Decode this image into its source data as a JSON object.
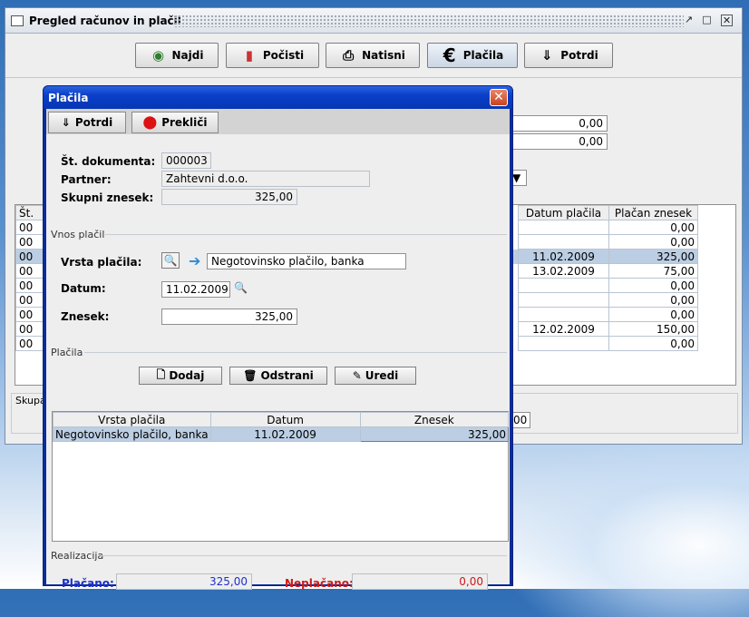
{
  "main": {
    "title": "Pregled računov in plačil",
    "toolbar": {
      "najdi": "Najdi",
      "pocisti": "Počisti",
      "natisni": "Natisni",
      "placila": "Plačila",
      "potrdi": "Potrdi"
    },
    "values": {
      "v1": "0,00",
      "v2": "0,00"
    },
    "table": {
      "headers": [
        "Št.",
        "Datum plačila",
        "Plačan znesek"
      ],
      "rows": [
        {
          "st": "00",
          "datum": "",
          "znesek": "0,00"
        },
        {
          "st": "00",
          "datum": "",
          "znesek": "0,00"
        },
        {
          "st": "00",
          "datum": "11.02.2009",
          "znesek": "325,00"
        },
        {
          "st": "00",
          "datum": "13.02.2009",
          "znesek": "75,00"
        },
        {
          "st": "00",
          "datum": "",
          "znesek": "0,00"
        },
        {
          "st": "00",
          "datum": "",
          "znesek": "0,00"
        },
        {
          "st": "00",
          "datum": "",
          "znesek": "0,00"
        },
        {
          "st": "00",
          "datum": "12.02.2009",
          "znesek": "150,00"
        },
        {
          "st": "00",
          "datum": "",
          "znesek": "0,00"
        }
      ]
    },
    "skupaj_label": "Skupa",
    "skupaj_value": "00"
  },
  "dialog": {
    "title": "Plačila",
    "close": "✕",
    "potrdi": "Potrdi",
    "preklici": "Prekliči",
    "st_dokumenta_label": "Št. dokumenta:",
    "st_dokumenta": "000003",
    "partner_label": "Partner:",
    "partner": "Zahtevni d.o.o.",
    "skupni_znesek_label": "Skupni znesek:",
    "skupni_znesek": "325,00",
    "vnos_group": "Vnos plačil",
    "vrsta_label": "Vrsta plačila:",
    "vrsta_value": "Negotovinsko plačilo, banka",
    "datum_label": "Datum:",
    "datum_value": "11.02.2009",
    "znesek_label": "Znesek:",
    "znesek_value": "325,00",
    "placila_group": "Plačila",
    "dodaj": "Dodaj",
    "odstrani": "Odstrani",
    "uredi": "Uredi",
    "table_headers": [
      "Vrsta plačila",
      "Datum",
      "Znesek"
    ],
    "table_rows": [
      {
        "vrsta": "Negotovinsko plačilo, banka",
        "datum": "11.02.2009",
        "znesek": "325,00"
      }
    ],
    "realizacija_group": "Realizacija",
    "placano_label": "Plačano:",
    "placano_value": "325,00",
    "neplacano_label": "Neplačano:",
    "neplacano_value": "0,00",
    "colors": {
      "placano": "#1e2fc8",
      "neplacano": "#d01818",
      "title_bar": "#0a3fc9"
    }
  }
}
